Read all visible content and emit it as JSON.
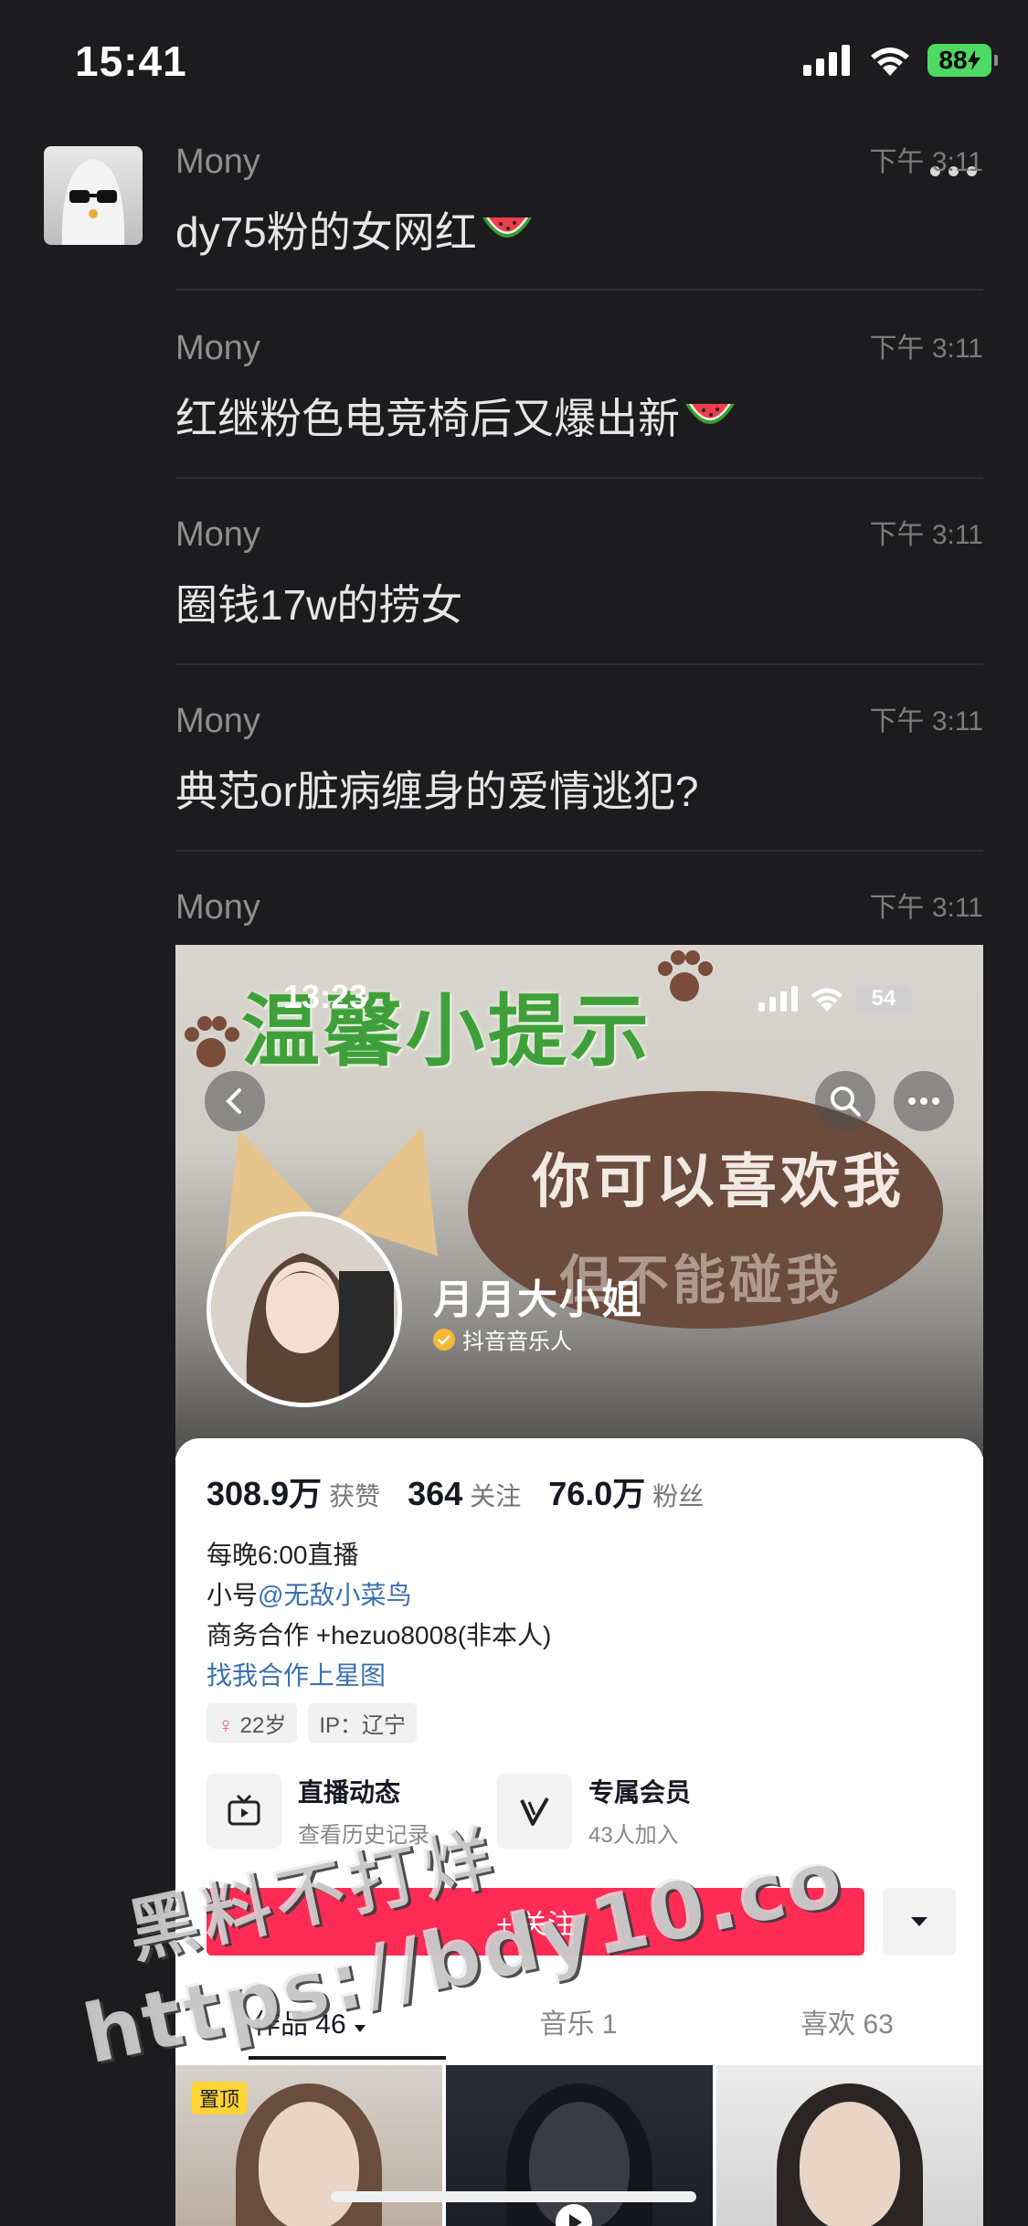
{
  "status_bar": {
    "time": "15:41",
    "battery": "88"
  },
  "messages": [
    {
      "sender": "Mony",
      "time": "下午 3:11",
      "text": "dy75粉的女网红",
      "emoji": "watermelon"
    },
    {
      "sender": "Mony",
      "time": "下午 3:11",
      "text": "红继粉色电竞椅后又爆出新",
      "emoji": "watermelon"
    },
    {
      "sender": "Mony",
      "time": "下午 3:11",
      "text": "圈钱17w的捞女"
    },
    {
      "sender": "Mony",
      "time": "下午 3:11",
      "text": "典范or脏病缠身的爱情逃犯?"
    },
    {
      "sender": "Mony",
      "time": "下午 3:11",
      "text": ""
    }
  ],
  "embedded": {
    "status_time": "13:23",
    "battery": "54",
    "banner_title": "温馨小提示",
    "banner_line1": "你可以喜欢我",
    "banner_line2": "但不能碰我",
    "profile_name": "月月大小姐",
    "profile_tag": "抖音音乐人",
    "stats": [
      {
        "num": "308.9万",
        "label": "获赞"
      },
      {
        "num": "364",
        "label": "关注"
      },
      {
        "num": "76.0万",
        "label": "粉丝"
      }
    ],
    "bio_line1": "每晚6:00直播",
    "bio_line2_prefix": "小号",
    "bio_line2_link": "@无敌小菜鸟",
    "bio_line3": "商务合作 +hezuo8008(非本人)",
    "bio_line4": "找我合作上星图",
    "chip_age": "22岁",
    "chip_ip": "IP：辽宁",
    "feature1_title": "直播动态",
    "feature1_sub": "查看历史记录",
    "feature2_title": "专属会员",
    "feature2_sub": "43人加入",
    "follow_label": "+ 关注",
    "tabs": [
      {
        "label": "作品 46"
      },
      {
        "label": "音乐 1"
      },
      {
        "label": "喜欢 63"
      }
    ],
    "pin_label": "置顶"
  },
  "watermark": {
    "line1": "黑料不打烊",
    "line2": "https://bdy10.co"
  },
  "colors": {
    "background": "#1c1c1e",
    "follow": "#fe2c55",
    "link": "#3a6fb5",
    "battery": "#4cd964"
  }
}
